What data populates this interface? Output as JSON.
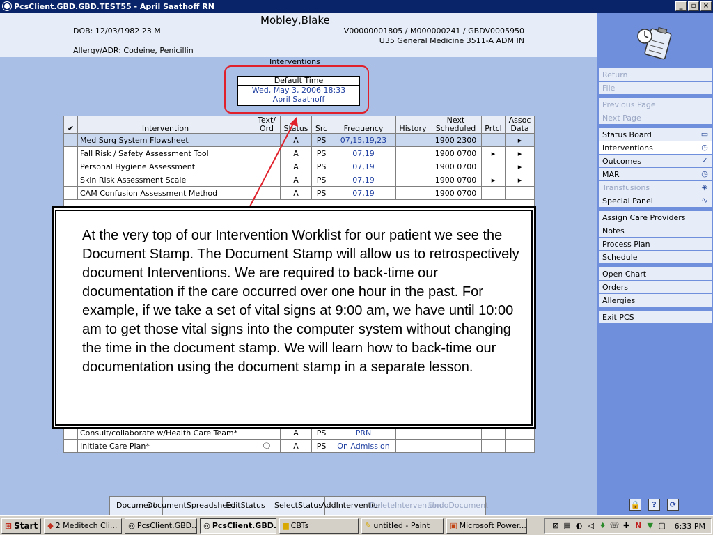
{
  "window": {
    "title": "PcsClient.GBD.GBD.TEST55 - April Saathoff RN",
    "btn_min": "_",
    "btn_max": "▫",
    "btn_close": "×"
  },
  "patient": {
    "name": "Mobley,Blake",
    "dob": "DOB: 12/03/1982 23 M",
    "allergy": "Allergy/ADR: Codeine, Penicillin",
    "account": "V00000001805 / M000000241 / GBDV0005950",
    "location": "U35 General Medicine  3511-A  ADM IN"
  },
  "section_title": "Interventions",
  "stamp": {
    "header": "Default Time",
    "datetime": "Wed, May 3, 2006  18:33",
    "user": "April Saathoff"
  },
  "table": {
    "headers": {
      "check": "✔",
      "intervention": "Intervention",
      "text_a": "Text/",
      "text_b": "Ord",
      "status": "Status",
      "src": "Src",
      "frequency": "Frequency",
      "history": "History",
      "next_a": "Next",
      "next_b": "Scheduled",
      "prtcl": "Prtcl",
      "assoc_a": "Assoc",
      "assoc_b": "Data"
    },
    "rows": [
      {
        "name": "Med Surg System Flowsheet",
        "text": "",
        "status": "A",
        "src": "PS",
        "freq": "07,15,19,23",
        "history": "",
        "next": "1900 2300",
        "prtcl": "",
        "assoc": "▸"
      },
      {
        "name": "Fall Risk / Safety Assessment Tool",
        "text": "",
        "status": "A",
        "src": "PS",
        "freq": "07,19",
        "history": "",
        "next": "1900 0700",
        "prtcl": "▸",
        "assoc": "▸"
      },
      {
        "name": "Personal Hygiene Assessment",
        "text": "",
        "status": "A",
        "src": "PS",
        "freq": "07,19",
        "history": "",
        "next": "1900 0700",
        "prtcl": "",
        "assoc": "▸"
      },
      {
        "name": "Skin Risk Assessment Scale",
        "text": "",
        "status": "A",
        "src": "PS",
        "freq": "07,19",
        "history": "",
        "next": "1900 0700",
        "prtcl": "▸",
        "assoc": "▸"
      },
      {
        "name": "CAM Confusion Assessment Method",
        "text": "",
        "status": "A",
        "src": "PS",
        "freq": "07,19",
        "history": "",
        "next": "1900 0700",
        "prtcl": "",
        "assoc": ""
      },
      {
        "name": "Consult/collaborate w/Health Care Team*",
        "text": "",
        "status": "A",
        "src": "PS",
        "freq": "PRN",
        "history": "",
        "next": "",
        "prtcl": "",
        "assoc": ""
      },
      {
        "name": "Initiate Care Plan*",
        "text": "🗨",
        "status": "A",
        "src": "PS",
        "freq": "On Admission",
        "history": "",
        "next": "",
        "prtcl": "",
        "assoc": ""
      }
    ]
  },
  "callout": "At the very top of our Intervention Worklist for our patient we see the Document Stamp. The Document Stamp will allow us to retrospectively document Interventions. We are required to back-time our documentation if the care occurred over one hour in the past. For example, if we take a set of vital signs at 9:00 am, we have until 10:00 am to get those vital signs into the computer system without changing the time in the document stamp. We will learn how to back-time our documentation using the document stamp in a separate lesson.",
  "toolbar": {
    "document": "Document",
    "spreadsheet_a": "Document",
    "spreadsheet_b": "Spreadsheet",
    "edit_a": "Edit",
    "edit_b": "Status",
    "select_a": "Select",
    "select_b": "Status",
    "add_a": "Add",
    "add_b": "Intervention",
    "delete_a": "Delete",
    "delete_b": "Intervention",
    "undo_a": "Undo",
    "undo_b": "Document"
  },
  "sidebar": {
    "group1": [
      "Return",
      "File"
    ],
    "group2": [
      "Previous Page",
      "Next Page"
    ],
    "group3": [
      "Status Board",
      "Interventions",
      "Outcomes",
      "MAR",
      "Transfusions",
      "Special Panel"
    ],
    "group4": [
      "Assign Care Providers",
      "Notes",
      "Process Plan",
      "Schedule"
    ],
    "group5": [
      "Open Chart",
      "Orders",
      "Allergies"
    ],
    "group6": [
      "Exit PCS"
    ],
    "btn_lock": "🔒",
    "btn_help": "?",
    "btn_refresh": "⟳"
  },
  "taskbar": {
    "start": "Start",
    "items": [
      "2 Meditech Cli...",
      "PcsClient.GBD....",
      "PcsClient.GBD...",
      "CBTs",
      "untitled - Paint",
      "Microsoft Power..."
    ],
    "clock": "6:33 PM"
  },
  "colors": {
    "titlebar": "#0a246a",
    "main_bg": "#a9bfe6",
    "sidebar_bg": "#6f8fdc",
    "stamp_ring": "#e0202a",
    "arrow": "#e0202a"
  }
}
